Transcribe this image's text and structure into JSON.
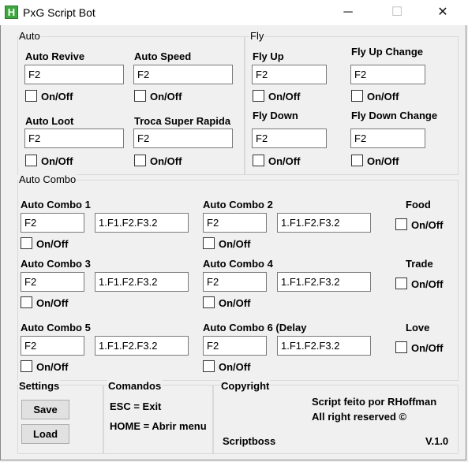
{
  "window": {
    "title": "PxG Script Bot",
    "app_icon_letter": "H",
    "minimize": "─",
    "maximize": "☐",
    "close": "✕"
  },
  "auto": {
    "group_label": "Auto",
    "revive": {
      "label": "Auto Revive",
      "value": "F2",
      "toggle": "On/Off"
    },
    "speed": {
      "label": "Auto Speed",
      "value": "F2",
      "toggle": "On/Off"
    },
    "loot": {
      "label": "Auto Loot",
      "value": "F2",
      "toggle": "On/Off"
    },
    "troca": {
      "label": "Troca Super Rapida",
      "value": "F2",
      "toggle": "On/Off"
    }
  },
  "fly": {
    "group_label": "Fly",
    "up": {
      "label": "Fly Up",
      "value": "F2",
      "toggle": "On/Off"
    },
    "up_change": {
      "label": "Fly Up Change",
      "value": "F2",
      "toggle": "On/Off"
    },
    "down": {
      "label": "Fly Down",
      "value": "F2",
      "toggle": "On/Off"
    },
    "down_change": {
      "label": "Fly Down Change",
      "value": "F2",
      "toggle": "On/Off"
    }
  },
  "combo": {
    "group_label": "Auto Combo",
    "c1": {
      "label": "Auto Combo 1",
      "key": "F2",
      "seq": "1.F1.F2.F3.2",
      "toggle": "On/Off"
    },
    "c2": {
      "label": "Auto Combo 2",
      "key": "F2",
      "seq": "1.F1.F2.F3.2",
      "toggle": "On/Off"
    },
    "c3": {
      "label": "Auto Combo 3",
      "key": "F2",
      "seq": "1.F1.F2.F3.2",
      "toggle": "On/Off"
    },
    "c4": {
      "label": "Auto Combo 4",
      "key": "F2",
      "seq": "1.F1.F2.F3.2",
      "toggle": "On/Off"
    },
    "c5": {
      "label": "Auto Combo 5",
      "key": "F2",
      "seq": "1.F1.F2.F3.2",
      "toggle": "On/Off"
    },
    "c6": {
      "label": "Auto Combo 6 (Delay",
      "key": "F2",
      "seq": "1.F1.F2.F3.2",
      "toggle": "On/Off"
    },
    "food": {
      "label": "Food",
      "toggle": "On/Off"
    },
    "trade": {
      "label": "Trade",
      "toggle": "On/Off"
    },
    "love": {
      "label": "Love",
      "toggle": "On/Off"
    }
  },
  "settings": {
    "label": "Settings",
    "save": "Save",
    "load": "Load"
  },
  "comandos": {
    "label": "Comandos",
    "esc": "ESC = Exit",
    "home": "HOME = Abrir menu"
  },
  "copyright": {
    "label": "Copyright",
    "line1": "Script feito por RHoffman",
    "line2": "All right reserved ©",
    "brand": "Scriptboss",
    "version": "V.1.0"
  }
}
